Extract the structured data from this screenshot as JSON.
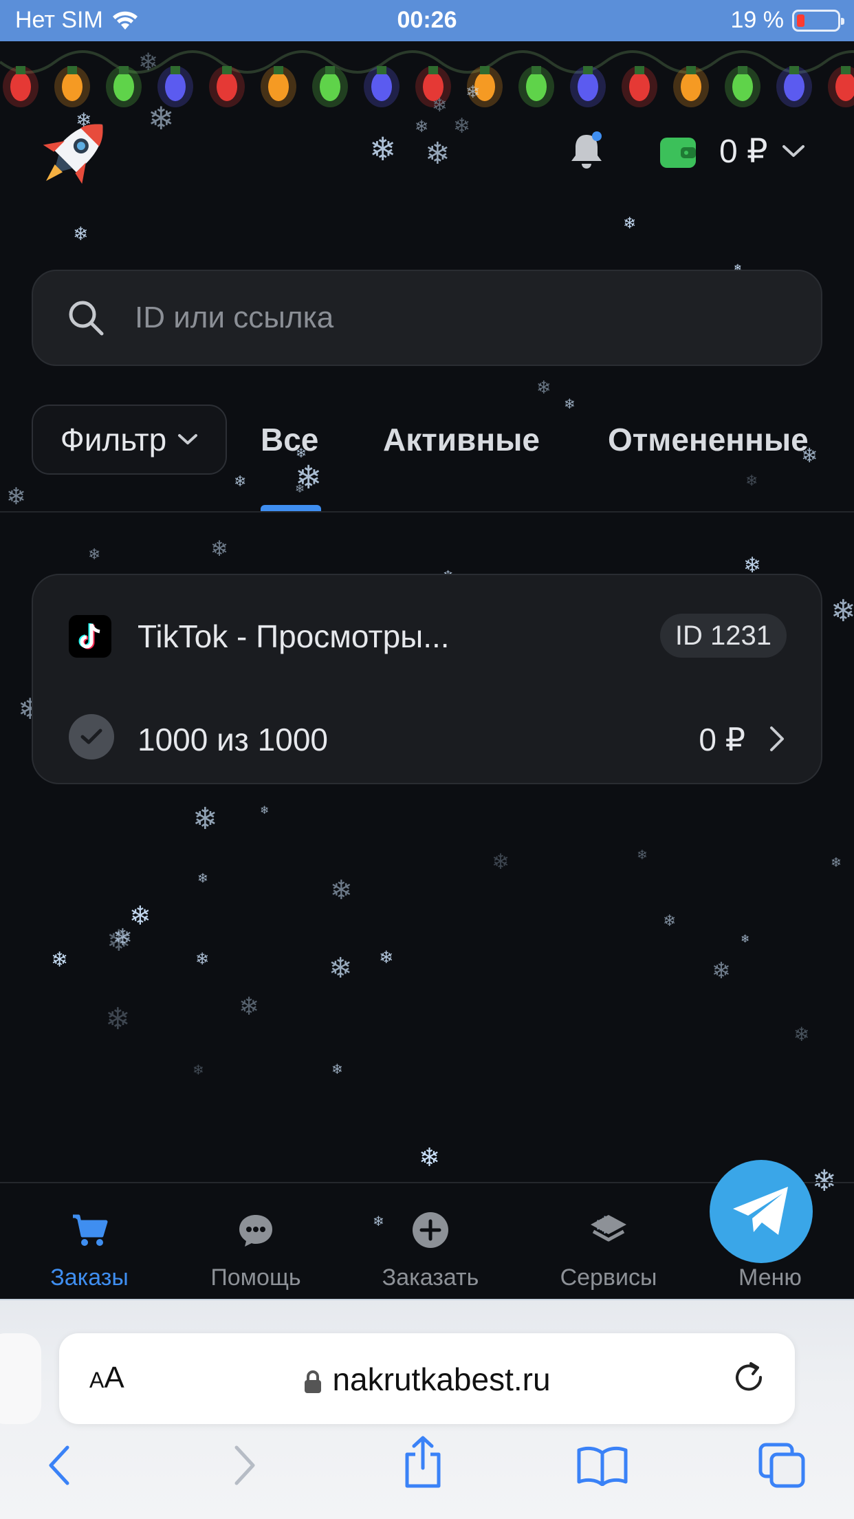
{
  "status_bar": {
    "carrier": "Нет SIM",
    "time": "00:26",
    "battery_percent": "19 %",
    "battery_level": 0.19,
    "icons": [
      "wifi-icon",
      "battery-icon"
    ]
  },
  "header": {
    "logo_icon": "rocket-icon",
    "notification_icon": "bell-icon",
    "wallet_icon": "wallet-icon",
    "balance": "0 ₽",
    "balance_dropdown_icon": "chevron-down-icon"
  },
  "search": {
    "placeholder": "ID или ссылка",
    "value": ""
  },
  "filters": {
    "filter_label": "Фильтр",
    "tabs": [
      {
        "label": "Все",
        "active": true
      },
      {
        "label": "Активные",
        "active": false
      },
      {
        "label": "Отмененные",
        "active": false
      }
    ]
  },
  "orders": [
    {
      "service_icon": "tiktok-icon",
      "title": "TikTok - Просмотры...",
      "id": "ID 1231",
      "status_icon": "check-icon",
      "progress": "1000 из 1000",
      "price": "0 ₽"
    }
  ],
  "bottom_nav": [
    {
      "label": "Заказы",
      "icon": "cart-icon",
      "active": true
    },
    {
      "label": "Помощь",
      "icon": "chat-icon",
      "active": false
    },
    {
      "label": "Заказать",
      "icon": "plus-icon",
      "active": false
    },
    {
      "label": "Сервисы",
      "icon": "layers-icon",
      "active": false
    },
    {
      "label": "Меню",
      "icon": "menu-icon",
      "active": false
    }
  ],
  "telegram_button_icon": "telegram-icon",
  "safari": {
    "text_size_label_small": "A",
    "text_size_label_large": "A",
    "url": "nakrutkabest.ru",
    "toolbar": [
      "back-icon",
      "forward-icon",
      "share-icon",
      "bookmarks-icon",
      "tabs-icon"
    ]
  },
  "colors": {
    "accent": "#3f8ef0",
    "background": "#0c0e12",
    "card": "#1a1c20",
    "status_bar": "#5b8fd9",
    "telegram": "#3aa6e8",
    "wallet": "#3cc05a"
  }
}
